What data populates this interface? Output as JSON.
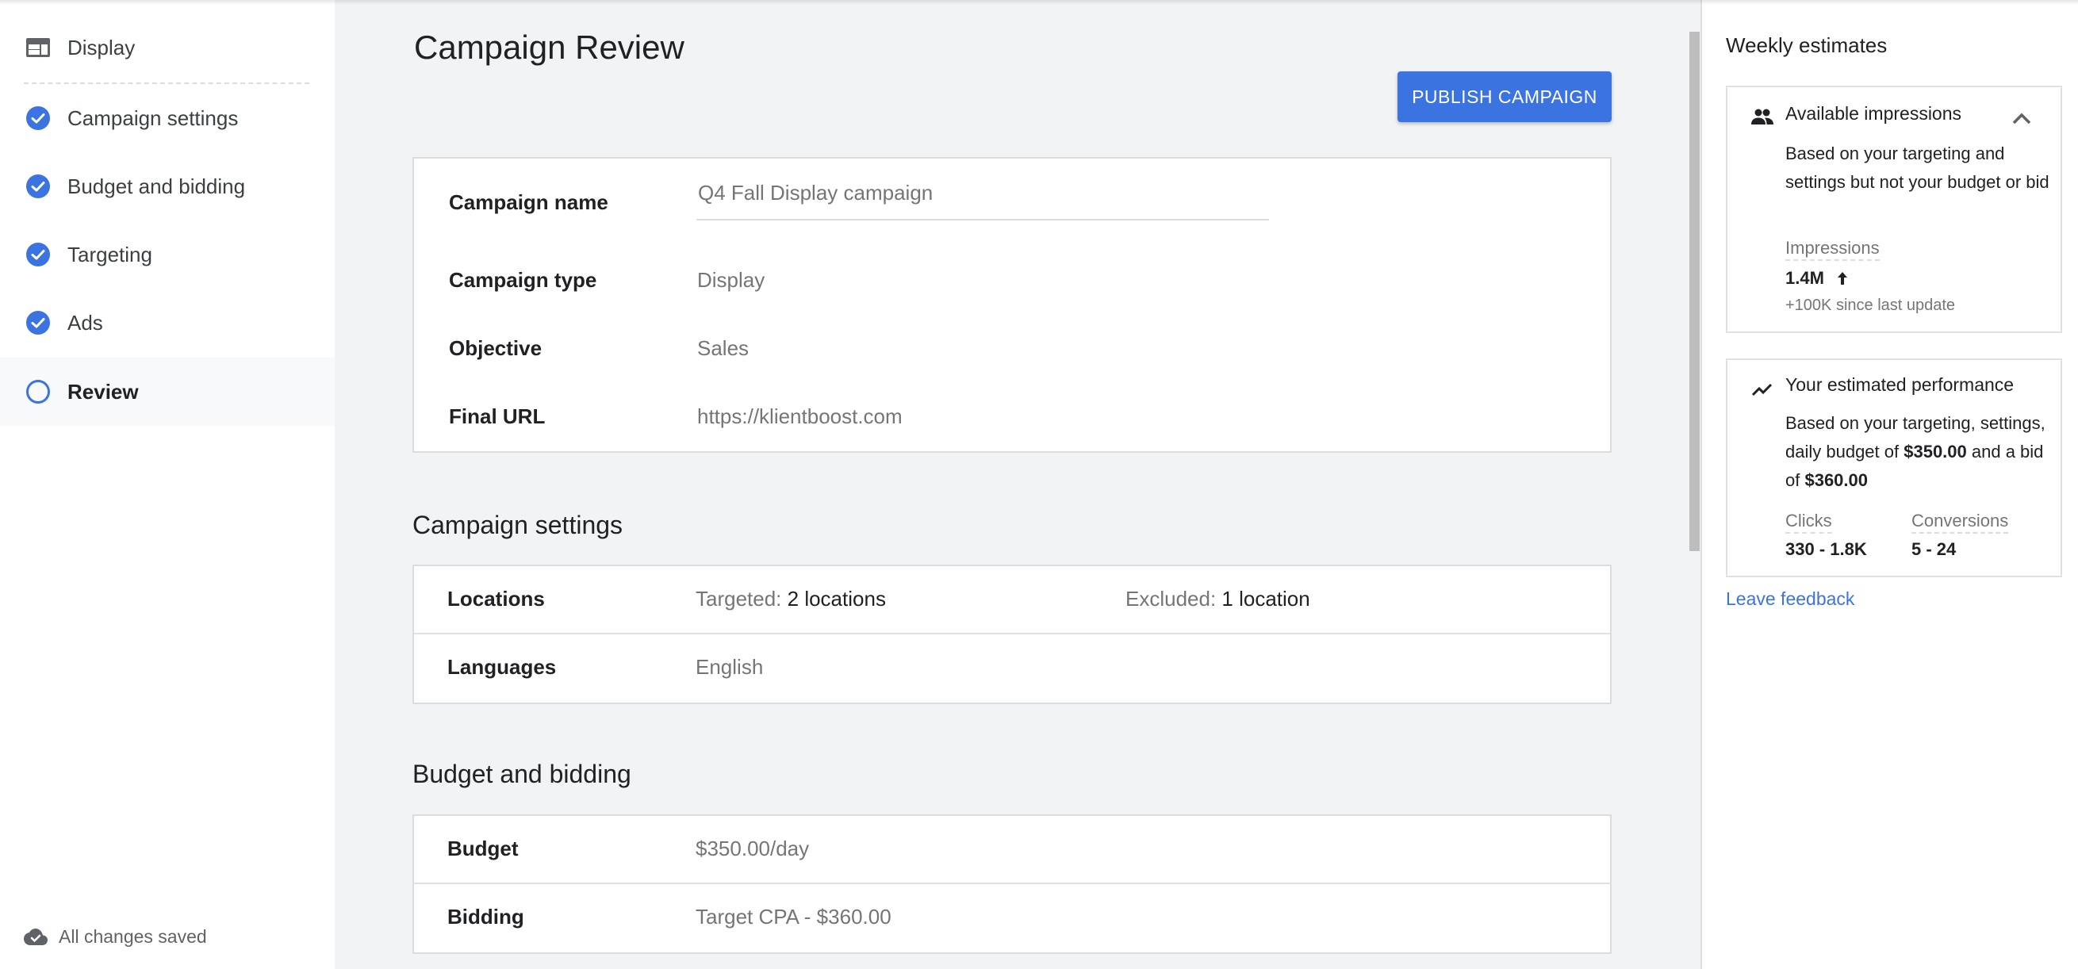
{
  "sidebar": {
    "header": {
      "label": "Display",
      "icon": "display-layout-icon"
    },
    "items": [
      {
        "label": "Campaign settings",
        "status": "complete",
        "icon": "check-circle-icon"
      },
      {
        "label": "Budget and bidding",
        "status": "complete",
        "icon": "check-circle-icon"
      },
      {
        "label": "Targeting",
        "status": "complete",
        "icon": "check-circle-icon"
      },
      {
        "label": "Ads",
        "status": "complete",
        "icon": "check-circle-icon"
      },
      {
        "label": "Review",
        "status": "current",
        "icon": "circle-outline-icon"
      }
    ],
    "save_status": {
      "label": "All changes saved",
      "icon": "cloud-done-icon"
    }
  },
  "main": {
    "title": "Campaign Review",
    "publish_button": "PUBLISH CAMPAIGN",
    "overview": {
      "campaign_name_label": "Campaign name",
      "campaign_name_value": "Q4 Fall Display campaign",
      "campaign_type_label": "Campaign type",
      "campaign_type_value": "Display",
      "objective_label": "Objective",
      "objective_value": "Sales",
      "final_url_label": "Final URL",
      "final_url_value": "https://klientboost.com"
    },
    "campaign_settings": {
      "title": "Campaign settings",
      "locations_label": "Locations",
      "targeted_prefix": "Targeted:",
      "targeted_value": "2 locations",
      "excluded_prefix": "Excluded:",
      "excluded_value": "1 location",
      "languages_label": "Languages",
      "languages_value": "English"
    },
    "budget_bidding": {
      "title": "Budget and bidding",
      "budget_label": "Budget",
      "budget_value": "$350.00/day",
      "bidding_label": "Bidding",
      "bidding_value": "Target CPA - $360.00"
    }
  },
  "estimates": {
    "title": "Weekly estimates",
    "impressions_card": {
      "title": "Available impressions",
      "icon": "people-icon",
      "description": "Based on your targeting and settings but not your budget or bid",
      "metric_label": "Impressions",
      "metric_value": "1.4M",
      "trend": "up",
      "change_text": "+100K since last update"
    },
    "performance_card": {
      "title": "Your estimated performance",
      "icon": "trending-up-icon",
      "desc_part1": "Based on your targeting, settings, daily budget of ",
      "desc_budget": "$350.00",
      "desc_part2": " and a bid of ",
      "desc_bid": "$360.00",
      "clicks_label": "Clicks",
      "clicks_value": "330 - 1.8K",
      "conversions_label": "Conversions",
      "conversions_value": "5 - 24"
    },
    "feedback_link": "Leave feedback"
  },
  "colors": {
    "accent": "#3b73e0",
    "page_bg": "#f1f3f4",
    "text_primary": "#202124",
    "text_secondary": "#757575"
  }
}
